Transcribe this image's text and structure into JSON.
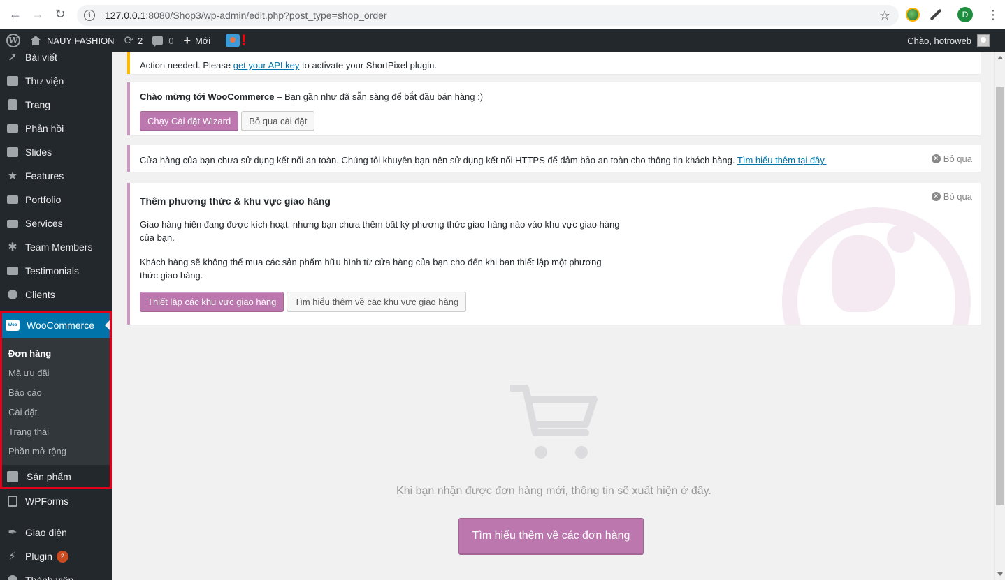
{
  "browser": {
    "url_host": "127.0.0.1",
    "url_rest": ":8080/Shop3/wp-admin/edit.php?post_type=shop_order",
    "profile_initial": "D"
  },
  "adminbar": {
    "site_name": "NAUY FASHION",
    "updates_count": "2",
    "comments_count": "0",
    "new_label": "Mới",
    "alert": "!",
    "greeting": "Chào, hotroweb"
  },
  "sidebar": {
    "items_top": [
      {
        "label": "Bài viết",
        "icon": "pin-icon"
      },
      {
        "label": "Thư viện",
        "icon": "media-icon"
      },
      {
        "label": "Trang",
        "icon": "page-icon"
      },
      {
        "label": "Phản hồi",
        "icon": "comment-icon"
      },
      {
        "label": "Slides",
        "icon": "slides-icon"
      },
      {
        "label": "Features",
        "icon": "star-icon"
      },
      {
        "label": "Portfolio",
        "icon": "folder-icon"
      },
      {
        "label": "Services",
        "icon": "services-icon"
      },
      {
        "label": "Team Members",
        "icon": "team-icon"
      },
      {
        "label": "Testimonials",
        "icon": "testimonial-icon"
      },
      {
        "label": "Clients",
        "icon": "clients-icon"
      }
    ],
    "woocommerce": {
      "label": "WooCommerce",
      "logo_text": "Woo",
      "submenu": [
        "Đơn hàng",
        "Mã ưu đãi",
        "Báo cáo",
        "Cài đặt",
        "Trạng thái",
        "Phần mở rộng"
      ],
      "products_label": "Sản phẩm"
    },
    "items_bottom": [
      {
        "label": "WPForms",
        "icon": "forms-icon"
      },
      {
        "label": "Giao diện",
        "icon": "brush-icon"
      },
      {
        "label": "Plugin",
        "icon": "plugin-icon",
        "badge": "2"
      },
      {
        "label": "Thành viên",
        "icon": "users-icon"
      }
    ]
  },
  "notices": {
    "shortpixel": {
      "before": "Action needed. Please ",
      "link": "get your API key",
      "after": " to activate your ShortPixel plugin."
    },
    "welcome": {
      "title": "Chào mừng tới WooCommerce",
      "text": " – Bạn gần như đã sẵn sàng để bắt đầu bán hàng :)",
      "primary": "Chạy Cài đặt Wizard",
      "secondary": "Bỏ qua cài đặt"
    },
    "https": {
      "text": "Cửa hàng của bạn chưa sử dụng kết nối an toàn. Chúng tôi khuyên bạn nên sử dụng kết nối HTTPS để đảm bảo an toàn cho thông tin khách hàng. ",
      "link": "Tìm hiểu thêm tại đây.",
      "dismiss": "Bỏ qua"
    },
    "shipping": {
      "title": "Thêm phương thức & khu vực giao hàng",
      "p1": "Giao hàng hiện đang được kích hoạt, nhưng bạn chưa thêm bất kỳ phương thức giao hàng nào vào khu vực giao hàng của bạn.",
      "p2": "Khách hàng sẽ không thể mua các sản phẩm hữu hình từ cửa hàng của bạn cho đến khi bạn thiết lập một phương thức giao hàng.",
      "primary": "Thiết lập các khu vực giao hàng",
      "secondary": "Tìm hiểu thêm về các khu vực giao hàng",
      "dismiss": "Bỏ qua"
    }
  },
  "empty_state": {
    "message": "Khi bạn nhận được đơn hàng mới, thông tin sẽ xuất hiện ở đây.",
    "button": "Tìm hiểu thêm về các đơn hàng"
  },
  "colors": {
    "accent": "#bb77ae",
    "admin_dark": "#23282d",
    "wp_blue": "#0073aa",
    "highlight_border": "#e3001b"
  }
}
